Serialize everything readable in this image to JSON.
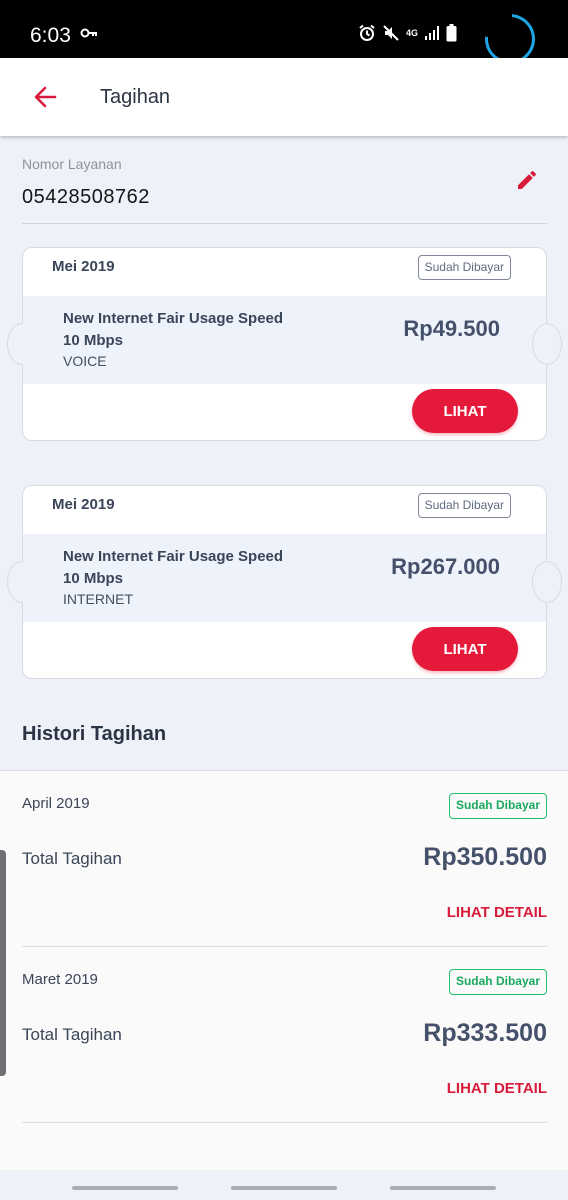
{
  "status_bar": {
    "time": "6:03",
    "network": "4G",
    "icons": [
      "key-icon",
      "alarm-icon",
      "mute-icon",
      "signal-icon",
      "battery-icon",
      "loading-spinner"
    ]
  },
  "app_bar": {
    "title": "Tagihan",
    "back_icon": "arrow-left-icon"
  },
  "service": {
    "label": "Nomor Layanan",
    "number": "05428508762",
    "edit_icon": "pencil-icon"
  },
  "bills": [
    {
      "month": "Mei 2019",
      "status": "Sudah Dibayar",
      "name_line1": "New Internet Fair Usage Speed",
      "name_line2": "10 Mbps",
      "type": "VOICE",
      "amount": "Rp49.500",
      "button_label": "LIHAT"
    },
    {
      "month": "Mei 2019",
      "status": "Sudah Dibayar",
      "name_line1": "New Internet Fair Usage Speed",
      "name_line2": "10 Mbps",
      "type": "INTERNET",
      "amount": "Rp267.000",
      "button_label": "LIHAT"
    }
  ],
  "history": {
    "title": "Histori Tagihan",
    "items": [
      {
        "month": "April 2019",
        "status": "Sudah Dibayar",
        "total_label": "Total Tagihan",
        "amount": "Rp350.500",
        "detail_label": "LIHAT DETAIL"
      },
      {
        "month": "Maret 2019",
        "status": "Sudah Dibayar",
        "total_label": "Total Tagihan",
        "amount": "Rp333.500",
        "detail_label": "LIHAT DETAIL"
      }
    ]
  },
  "colors": {
    "accent_red": "#e5193a",
    "paid_green": "#1fbf6a",
    "background": "#eef1f7"
  }
}
